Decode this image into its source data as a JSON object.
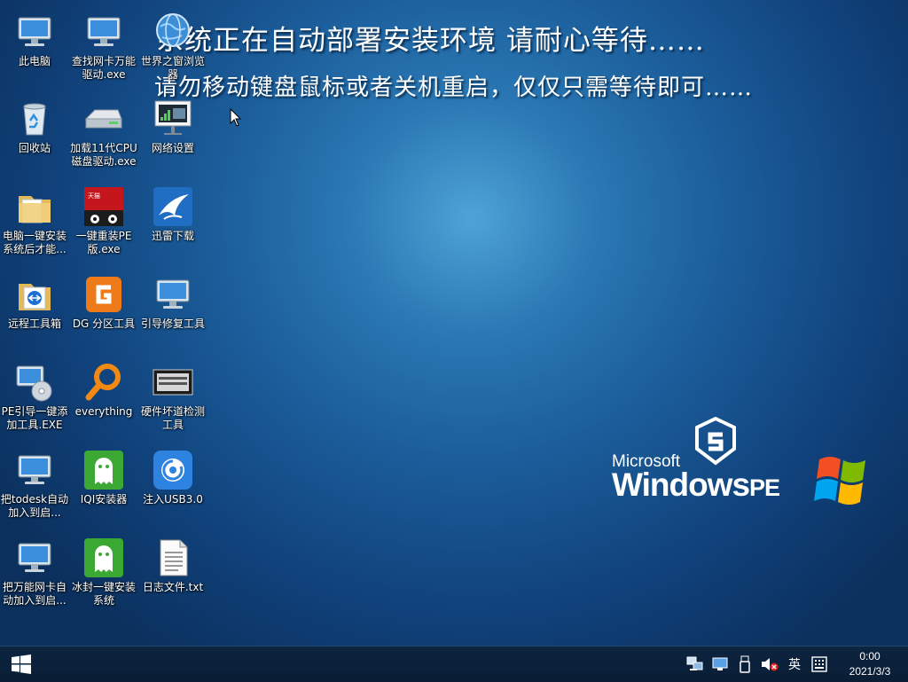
{
  "banner": {
    "line1": "系统正在自动部署安装环境 请耐心等待……",
    "line2": "请勿移动键盘鼠标或者关机重启，仅仅只需等待即可……"
  },
  "desktop_icons": [
    {
      "label": "此电脑",
      "icon": "computer-icon"
    },
    {
      "label": "查找网卡万能驱动.exe",
      "icon": "computer-icon"
    },
    {
      "label": "世界之窗浏览器",
      "icon": "globe-icon"
    },
    {
      "label": "回收站",
      "icon": "recycle-bin-icon"
    },
    {
      "label": "加载11代CPU磁盘驱动.exe",
      "icon": "disk-drive-icon"
    },
    {
      "label": "网络设置",
      "icon": "network-settings-icon"
    },
    {
      "label": "电脑一键安装系统后才能...",
      "icon": "folder-icon"
    },
    {
      "label": "一键重装PE版.exe",
      "icon": "tmall-icon"
    },
    {
      "label": "迅雷下载",
      "icon": "thunder-icon"
    },
    {
      "label": "远程工具箱",
      "icon": "teamviewer-folder-icon"
    },
    {
      "label": "DG 分区工具",
      "icon": "diskgenius-icon"
    },
    {
      "label": "引导修复工具",
      "icon": "computer-icon"
    },
    {
      "label": "PE引导一键添加工具.EXE",
      "icon": "computer-disc-icon"
    },
    {
      "label": "everything",
      "icon": "magnifier-icon"
    },
    {
      "label": "硬件坏道检测工具",
      "icon": "hdd-icon"
    },
    {
      "label": "把todesk自动加入到启...",
      "icon": "computer-icon"
    },
    {
      "label": "IQI安装器",
      "icon": "ghost-icon"
    },
    {
      "label": "注入USB3.0",
      "icon": "usb-inject-icon"
    },
    {
      "label": "把万能网卡自动加入到启...",
      "icon": "computer-icon"
    },
    {
      "label": "冰封一键安装系统",
      "icon": "ghost-icon"
    },
    {
      "label": "日志文件.txt",
      "icon": "text-file-icon"
    }
  ],
  "brand": {
    "microsoft": "Microsoft",
    "windows": "Windows",
    "pe": "PE"
  },
  "taskbar": {
    "ime": "英",
    "time": "0:00",
    "date": "2021/3/3"
  },
  "colors": {
    "desktop_center": "#4ea3d6",
    "desktop_edge": "#0b305d",
    "taskbar": "#0c2440"
  }
}
